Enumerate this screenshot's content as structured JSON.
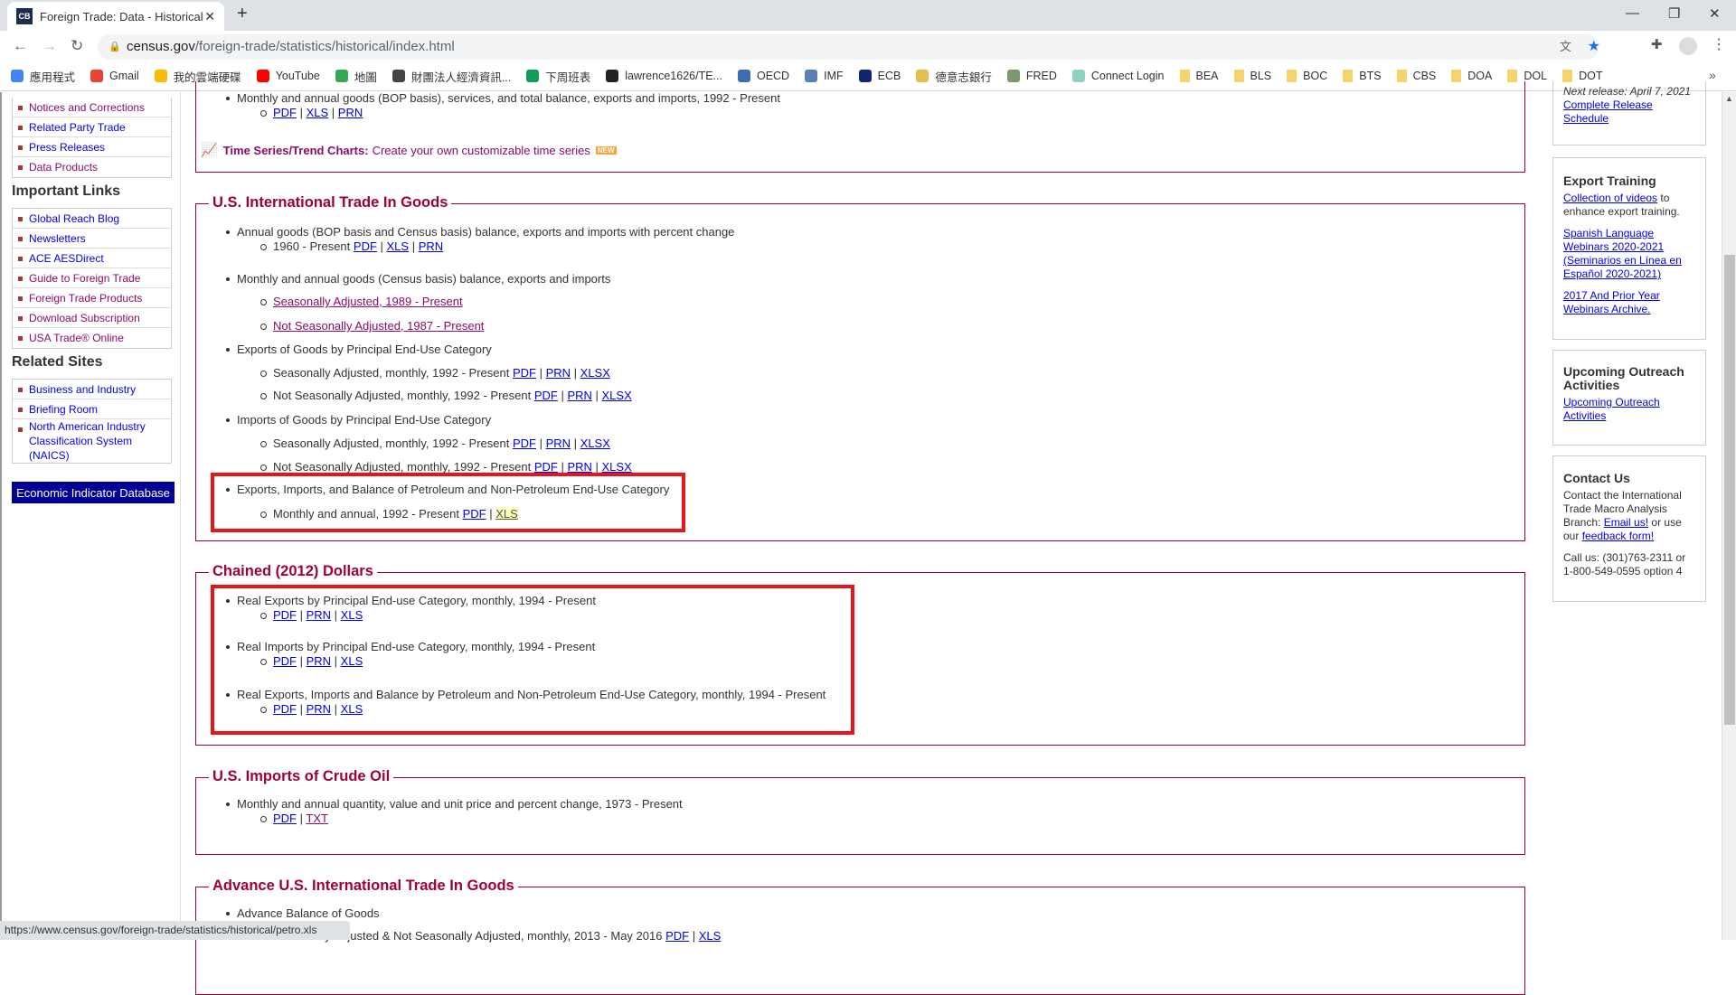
{
  "browser": {
    "tab_title": "Foreign Trade: Data - Historical",
    "tab_favicon": "CB",
    "url_host": "census.gov",
    "url_path": "/foreign-trade/statistics/historical/index.html",
    "bookmarks": [
      {
        "label": "應用程式",
        "icon": "apps-grid-icon",
        "color": "#4285f4"
      },
      {
        "label": "Gmail",
        "icon": "gmail-icon",
        "color": "#ea4335"
      },
      {
        "label": "我的雲端硬碟",
        "icon": "drive-icon",
        "color": "#fbbc04"
      },
      {
        "label": "YouTube",
        "icon": "youtube-icon",
        "color": "#ff0000"
      },
      {
        "label": "地圖",
        "icon": "maps-icon",
        "color": "#34a853"
      },
      {
        "label": "財團法人經濟資訊...",
        "icon": "globe-icon",
        "color": "#444444"
      },
      {
        "label": "下周班表",
        "icon": "sheet-icon",
        "color": "#0f9d58"
      },
      {
        "label": "lawrence1626/TE...",
        "icon": "github-icon",
        "color": "#222222"
      },
      {
        "label": "OECD",
        "icon": "oecd-icon",
        "color": "#3b6db3"
      },
      {
        "label": "IMF",
        "icon": "imf-icon",
        "color": "#5a7fb5"
      },
      {
        "label": "ECB",
        "icon": "ecb-icon",
        "color": "#10256e"
      },
      {
        "label": "德意志銀行",
        "icon": "bank-icon",
        "color": "#e6c04a"
      },
      {
        "label": "FRED",
        "icon": "fred-icon",
        "color": "#7a9a6b"
      },
      {
        "label": "Connect Login",
        "icon": "connect-icon",
        "color": "#8fd1c1"
      },
      {
        "label": "BEA",
        "icon": "folder-icon",
        "color": "#f6d36b"
      },
      {
        "label": "BLS",
        "icon": "folder-icon",
        "color": "#f6d36b"
      },
      {
        "label": "BOC",
        "icon": "folder-icon",
        "color": "#f6d36b"
      },
      {
        "label": "BTS",
        "icon": "folder-icon",
        "color": "#f6d36b"
      },
      {
        "label": "CBS",
        "icon": "folder-icon",
        "color": "#f6d36b"
      },
      {
        "label": "DOA",
        "icon": "folder-icon",
        "color": "#f6d36b"
      },
      {
        "label": "DOL",
        "icon": "folder-icon",
        "color": "#f6d36b"
      },
      {
        "label": "DOT",
        "icon": "folder-icon",
        "color": "#f6d36b"
      }
    ],
    "status_url": "https://www.census.gov/foreign-trade/statistics/historical/petro.xls"
  },
  "sidebar": {
    "group1": [
      {
        "label": "Notices and Corrections",
        "visited": true
      },
      {
        "label": "Related Party Trade",
        "visited": false
      },
      {
        "label": "Press Releases",
        "visited": false
      },
      {
        "label": "Data Products",
        "visited": true
      }
    ],
    "important_links_title": "Important Links",
    "important_links": [
      {
        "label": "Global Reach Blog",
        "visited": false
      },
      {
        "label": "Newsletters",
        "visited": false
      },
      {
        "label": "ACE AESDirect",
        "visited": false
      },
      {
        "label": "Guide to Foreign Trade",
        "visited": true
      },
      {
        "label": "Foreign Trade Products",
        "visited": true
      },
      {
        "label": "Download Subscription",
        "visited": true
      },
      {
        "label": "USA Trade® Online",
        "visited": true
      }
    ],
    "related_sites_title": "Related Sites",
    "related_sites": [
      {
        "label": "Business and Industry",
        "visited": false
      },
      {
        "label": "Briefing Room",
        "visited": false
      },
      {
        "label": "North American Industry Classification System (NAICS)",
        "visited": false
      }
    ],
    "economic_indicator_button": "Economic Indicator Database"
  },
  "main": {
    "top_section": {
      "item": "Monthly and annual goods (BOP basis), services, and total balance, exports and imports, 1992 - Present",
      "links": [
        "PDF",
        "XLS",
        "PRN"
      ],
      "time_series_label": "Time Series/Trend Charts:",
      "time_series_text": "Create your own customizable time series",
      "new_badge": "NEW"
    },
    "sections": [
      {
        "title": "U.S. International Trade In Goods",
        "items": [
          {
            "type": "b",
            "text": "Annual goods (BOP basis and Census basis) balance, exports and imports with percent change"
          },
          {
            "type": "s",
            "text": "1960 - Present",
            "links": [
              "PDF",
              "XLS",
              "PRN"
            ]
          },
          {
            "type": "b",
            "text": "Monthly and annual goods (Census basis) balance, exports and imports"
          },
          {
            "type": "s",
            "text": "",
            "links": [
              "Seasonally Adjusted, 1989 - Present"
            ],
            "visited": true
          },
          {
            "type": "s",
            "text": "",
            "links": [
              "Not Seasonally Adjusted, 1987 - Present"
            ],
            "visited": true
          },
          {
            "type": "b",
            "text": "Exports of Goods by Principal End-Use Category"
          },
          {
            "type": "s",
            "text": "Seasonally Adjusted, monthly, 1992 - Present",
            "links": [
              "PDF",
              "PRN",
              "XLSX"
            ]
          },
          {
            "type": "s",
            "text": "Not Seasonally Adjusted, monthly, 1992 - Present",
            "links": [
              "PDF",
              "PRN",
              "XLSX"
            ]
          },
          {
            "type": "b",
            "text": "Imports of Goods by Principal End-Use Category"
          },
          {
            "type": "s",
            "text": "Seasonally Adjusted, monthly, 1992 - Present",
            "links": [
              "PDF",
              "PRN",
              "XLSX"
            ]
          },
          {
            "type": "s",
            "text": "Not Seasonally Adjusted, monthly, 1992 - Present",
            "links": [
              "PDF",
              "PRN",
              "XLSX"
            ]
          },
          {
            "type": "b",
            "text": "Exports, Imports, and Balance of Petroleum and Non-Petroleum End-Use Category"
          },
          {
            "type": "s",
            "text": "Monthly and annual, 1992 - Present",
            "links": [
              "PDF",
              "XLS"
            ],
            "hover_last": true
          }
        ]
      },
      {
        "title": "Chained (2012) Dollars",
        "items": [
          {
            "type": "b",
            "text": "Real Exports by Principal End-use Category, monthly, 1994 - Present"
          },
          {
            "type": "s",
            "text": "",
            "links": [
              "PDF",
              "PRN",
              "XLS"
            ]
          },
          {
            "type": "b",
            "text": "Real Imports by Principal End-use Category, monthly, 1994 - Present"
          },
          {
            "type": "s",
            "text": "",
            "links": [
              "PDF",
              "PRN",
              "XLS"
            ]
          },
          {
            "type": "b",
            "text": "Real Exports, Imports and Balance by Petroleum and Non-Petroleum End-Use Category, monthly, 1994 - Present"
          },
          {
            "type": "s",
            "text": "",
            "links": [
              "PDF",
              "PRN",
              "XLS"
            ]
          }
        ]
      },
      {
        "title": "U.S. Imports of Crude Oil",
        "items": [
          {
            "type": "b",
            "text": "Monthly and annual quantity, value and unit price and percent change, 1973 - Present"
          },
          {
            "type": "s",
            "text": "",
            "links": [
              "PDF",
              "TXT"
            ],
            "visited_last": true
          }
        ]
      },
      {
        "title": "Advance U.S. International Trade In Goods",
        "items": [
          {
            "type": "b",
            "text": "Advance Balance of Goods"
          },
          {
            "type": "s",
            "text": "Seasonally Adjusted & Not Seasonally Adjusted, monthly, 2013 - May 2016",
            "links": [
              "PDF",
              "XLS"
            ]
          }
        ]
      }
    ]
  },
  "right": {
    "next_release": "Next release: April 7, 2021",
    "release_schedule_link": "Complete Release Schedule",
    "export_training_title": "Export Training",
    "videos_link": "Collection of videos",
    "videos_text": " to enhance export training.",
    "spanish_link": "Spanish Language Webinars 2020-2021 (Seminarios en Línea en Español 2020-2021)",
    "archive_link": "2017 And Prior Year Webinars Archive.",
    "outreach_title": "Upcoming Outreach Activities",
    "outreach_link": "Upcoming Outreach Activities",
    "contact_title": "Contact Us",
    "contact_text": "Contact the International Trade Macro Analysis Branch: ",
    "email_link": "Email us!",
    "or_use": " or use our ",
    "feedback_link": "feedback form!",
    "call_text": "Call us: (301)763-2311 or 1-800-549-0595 option 4"
  }
}
